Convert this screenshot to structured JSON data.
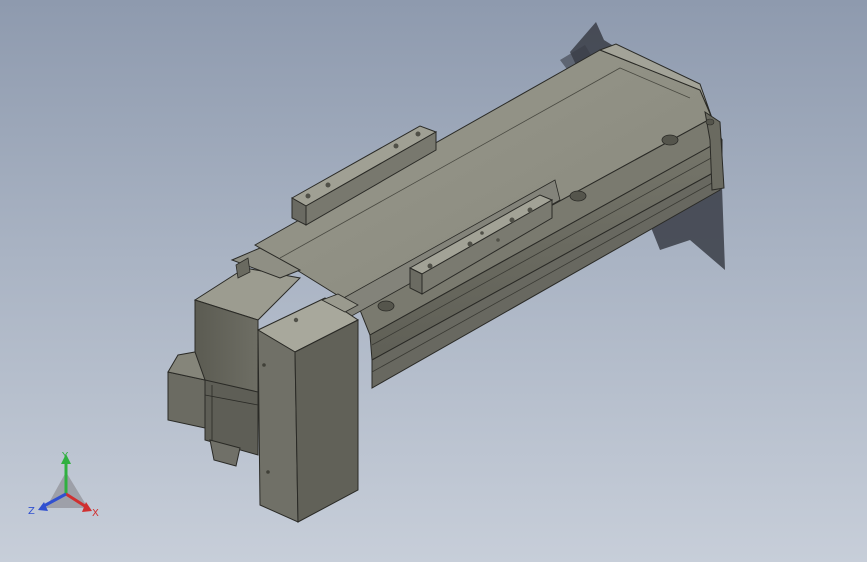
{
  "viewport": {
    "background_top": "#8e9aae",
    "background_bottom": "#c7ced9"
  },
  "model": {
    "body_color": "#8a8a80",
    "icons": [
      "linear-actuator-model"
    ]
  },
  "triad": {
    "x_label": "X",
    "y_label": "Y",
    "z_label": "Z",
    "x_color": "#d03030",
    "y_color": "#30b040",
    "z_color": "#3050d0"
  }
}
